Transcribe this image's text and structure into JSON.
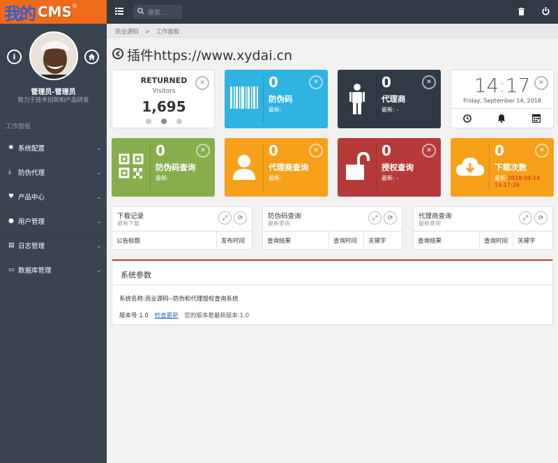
{
  "logo": {
    "part1": "我的",
    "part2": "CMS",
    "reg": "®"
  },
  "user": {
    "name": "管理员-管理员",
    "slogan": "致力于技术创新和产品研发"
  },
  "sidebar": {
    "heading": "工作面板",
    "items": [
      {
        "label": "系统配置",
        "icon": "gears-icon"
      },
      {
        "label": "防伪代理",
        "icon": "download-icon"
      },
      {
        "label": "产品中心",
        "icon": "heart-icon"
      },
      {
        "label": "用户管理",
        "icon": "users-icon"
      },
      {
        "label": "日志管理",
        "icon": "book-icon"
      },
      {
        "label": "数据库管理",
        "icon": "drive-icon"
      }
    ]
  },
  "topbar": {
    "search_placeholder": "搜索..."
  },
  "breadcrumb": {
    "item1": "商业源码",
    "sep": ">",
    "item2": "工作面板"
  },
  "page": {
    "title": "插件https://www.xydai.cn"
  },
  "visitors": {
    "title": "RETURNED",
    "sub": "Visitors",
    "value": "1,695"
  },
  "clock": {
    "hour": "14",
    "minute": "17",
    "date": "Friday, September 14, 2018"
  },
  "cards": [
    {
      "value": "0",
      "label": "防伪码",
      "latest": "最新:",
      "latest_value": "",
      "color": "#2fb3e2"
    },
    {
      "value": "0",
      "label": "代理商",
      "latest": "最新:",
      "latest_value": "-",
      "color": "#2f3a45"
    },
    {
      "value": "0",
      "label": "防伪码查询",
      "latest": "最新:",
      "latest_value": "",
      "color": "#86ae4c"
    },
    {
      "value": "0",
      "label": "代理商查询",
      "latest": "最新:",
      "latest_value": "",
      "color": "#f7a11a"
    },
    {
      "value": "0",
      "label": "授权查询",
      "latest": "最新:",
      "latest_value": "-",
      "color": "#b63a3a"
    },
    {
      "value": "0",
      "label": "下载次数",
      "latest": "最新:",
      "latest_value": "2018-09-14 14:17:26",
      "color": "#f7a11a"
    }
  ],
  "panels": [
    {
      "title": "下载记录",
      "sub": "最新下载",
      "cols": [
        "公告标题",
        "发布时间"
      ]
    },
    {
      "title": "防伪码查询",
      "sub": "最新查询",
      "cols": [
        "查询结果",
        "查询时间",
        "关键字"
      ]
    },
    {
      "title": "代理商查询",
      "sub": "最新查询",
      "cols": [
        "查询结果",
        "查询时间",
        "关键字"
      ]
    }
  ],
  "sysinfo": {
    "title": "系统参数",
    "name_label": "系统名称:",
    "name_value": "商业源码--防伪和代理授权查询系统",
    "version_label": "版本号:1.0",
    "check_link": "检查更新",
    "version_note": "您的版本是最新版本:1.0"
  }
}
